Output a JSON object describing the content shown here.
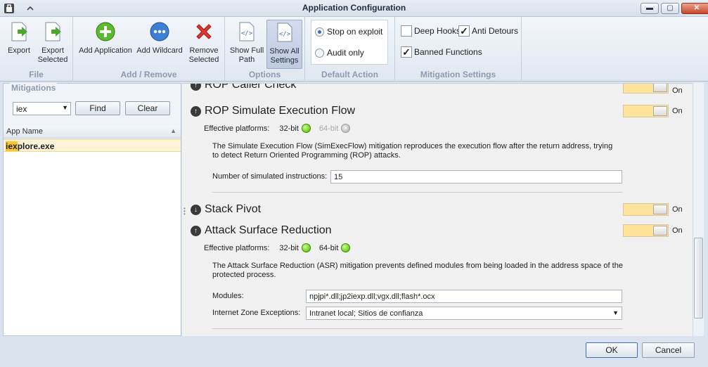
{
  "window": {
    "title": "Application Configuration"
  },
  "ribbon": {
    "groups": {
      "file": "File",
      "add_remove": "Add / Remove",
      "options": "Options",
      "default_action": "Default Action",
      "mitigation_settings": "Mitigation Settings"
    },
    "buttons": {
      "export": "Export",
      "export_selected_1": "Export",
      "export_selected_2": "Selected",
      "add_application": "Add Application",
      "add_wildcard": "Add Wildcard",
      "remove_selected_1": "Remove",
      "remove_selected_2": "Selected",
      "show_full_path_1": "Show Full",
      "show_full_path_2": "Path",
      "show_all_settings_1": "Show All",
      "show_all_settings_2": "Settings"
    },
    "default_action": {
      "stop_on_exploit": "Stop on exploit",
      "audit_only": "Audit only",
      "selected": "stop_on_exploit"
    },
    "mitigation_settings": {
      "deep_hooks": "Deep Hooks",
      "anti_detours": "Anti Detours",
      "banned_functions": "Banned Functions"
    }
  },
  "left": {
    "section_title": "Mitigations",
    "search_value": "iex",
    "find_label": "Find",
    "clear_label": "Clear",
    "column_header": "App Name",
    "rows": [
      {
        "highlight": "iex",
        "rest": "plore.exe"
      }
    ]
  },
  "main": {
    "partial_heading": "ROP Caller Check",
    "on_label": "On",
    "effective_platforms_label": "Effective platforms:",
    "bit32": "32-bit",
    "bit64": "64-bit",
    "rop_sim": {
      "title": "ROP Simulate Execution Flow",
      "description": "The Simulate Execution Flow (SimExecFlow) mitigation reproduces the execution flow after the return address, trying to detect Return Oriented Programming (ROP) attacks.",
      "instructions_label": "Number of simulated instructions:",
      "instructions_value": "15"
    },
    "stack_pivot": {
      "title": "Stack Pivot"
    },
    "asr": {
      "title": "Attack Surface Reduction",
      "description": "The Attack Surface Reduction (ASR) mitigation prevents defined modules from being loaded in the address space of the protected process.",
      "modules_label": "Modules:",
      "modules_value": "npjpi*.dll;jp2iexp.dll;vgx.dll;flash*.ocx",
      "zone_label": "Internet Zone Exceptions:",
      "zone_value": "Intranet local; Sitios de confianza"
    }
  },
  "footer": {
    "ok": "OK",
    "cancel": "Cancel"
  }
}
